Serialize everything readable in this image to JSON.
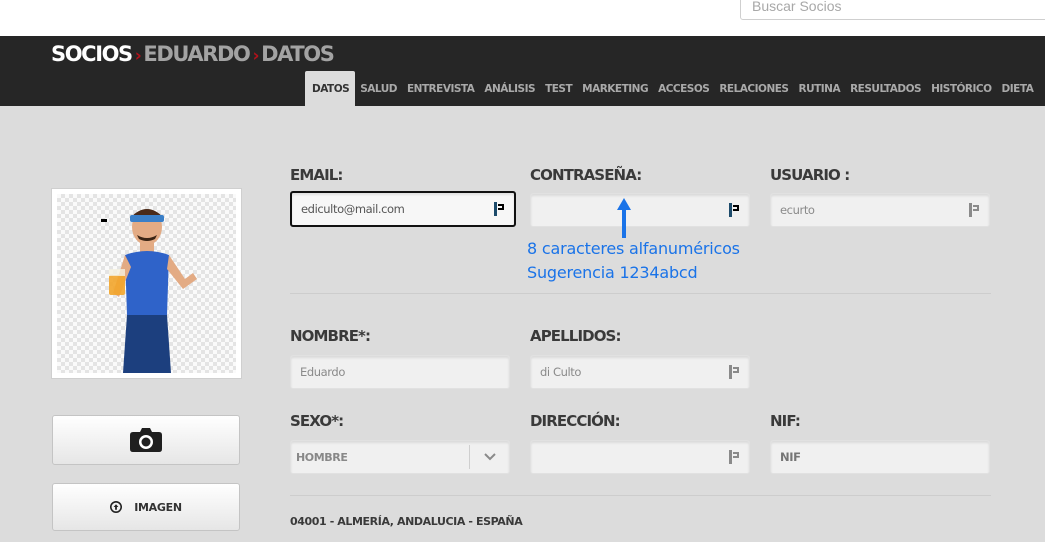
{
  "search": {
    "placeholder": "Buscar Socios"
  },
  "breadcrumb": {
    "section": "SOCIOS",
    "member": "EDUARDO",
    "page": "DATOS",
    "separator": "›"
  },
  "tabs": [
    {
      "label": "DATOS",
      "active": true
    },
    {
      "label": "SALUD"
    },
    {
      "label": "ENTREVISTA"
    },
    {
      "label": "ANÁLISIS"
    },
    {
      "label": "TEST"
    },
    {
      "label": "MARKETING"
    },
    {
      "label": "ACCESOS"
    },
    {
      "label": "RELACIONES"
    },
    {
      "label": "RUTINA"
    },
    {
      "label": "RESULTADOS"
    },
    {
      "label": "HISTÓRICO"
    },
    {
      "label": "DIETA"
    }
  ],
  "form": {
    "email": {
      "label": "EMAIL:",
      "value": "ediculto@mail.com"
    },
    "password": {
      "label": "CONTRASEÑA:",
      "value": ""
    },
    "username": {
      "label": "USUARIO :",
      "value": "ecurto"
    },
    "password_hint": {
      "line1": "8 caracteres alfanuméricos",
      "line2": "Sugerencia 1234abcd"
    },
    "first_name": {
      "label": "NOMBRE*:",
      "value": "Eduardo"
    },
    "last_name": {
      "label": "APELLIDOS:",
      "value": "di Culto"
    },
    "gender": {
      "label": "SEXO*:",
      "value": "HOMBRE"
    },
    "address": {
      "label": "DIRECCIÓN:",
      "value": ""
    },
    "nif": {
      "label": "NIF:",
      "value": "",
      "placeholder": "NIF"
    },
    "location": "04001 - ALMERÍA, ANDALUCIA - ESPAÑA"
  },
  "photo_buttons": {
    "image_label": "IMAGEN"
  },
  "icons": [
    "camera-icon",
    "upload-icon",
    "password-manager-icon",
    "chevron-down-icon",
    "arrow-up-icon"
  ],
  "colors": {
    "header_bg": "#262626",
    "accent_red": "#b0121b",
    "hint_blue": "#1a73e8",
    "page_bg": "#dcdcdc"
  }
}
